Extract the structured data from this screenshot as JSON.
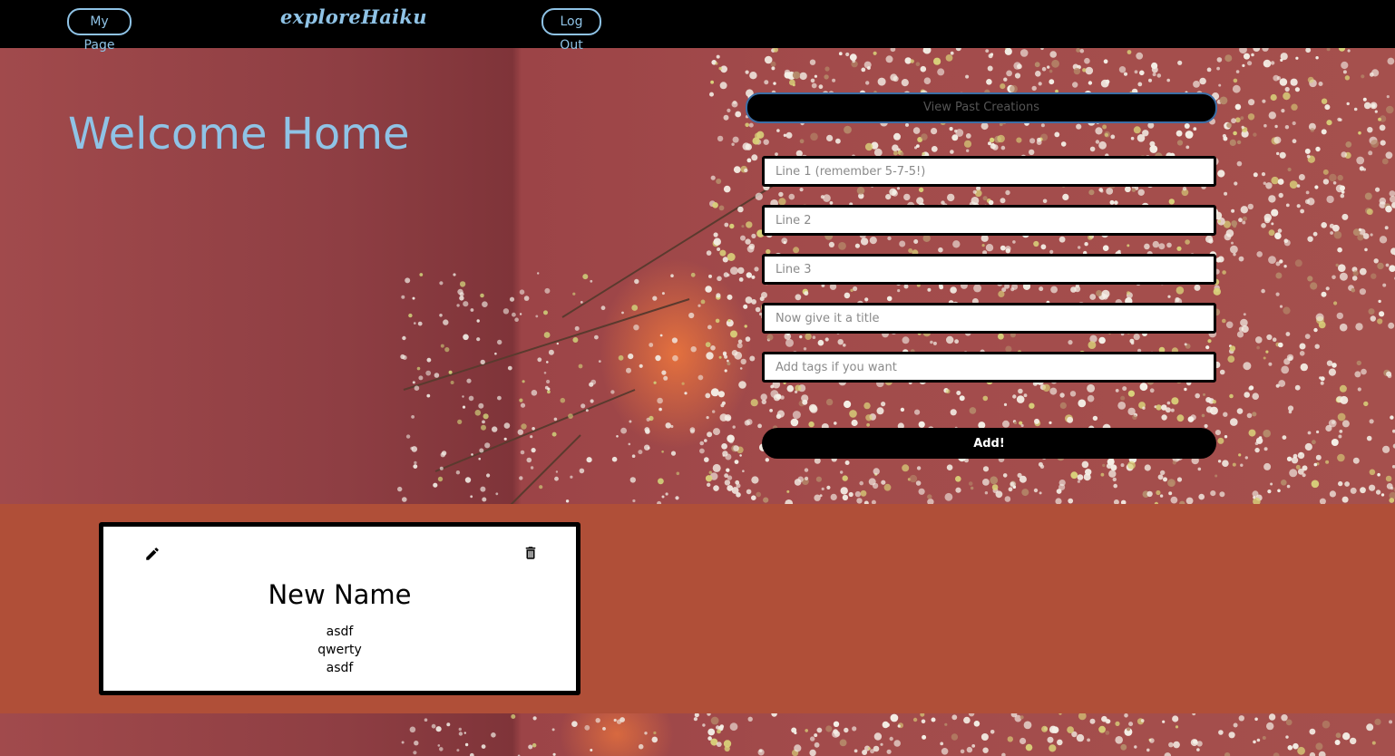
{
  "navbar": {
    "my_page": "My Page",
    "brand": "exploreHaiku",
    "log_out": "Log Out"
  },
  "hero": {
    "heading": "Welcome Home",
    "view_past": "View Past Creations"
  },
  "form": {
    "line1_placeholder": "Line 1 (remember 5-7-5!)",
    "line2_placeholder": "Line 2",
    "line3_placeholder": "Line 3",
    "title_placeholder": "Now give it a title",
    "tags_placeholder": "Add tags if you want",
    "add_label": "Add!"
  },
  "creations": [
    {
      "title": "New Name",
      "lines": [
        "asdf",
        "qwerty",
        "asdf"
      ],
      "edit_icon": "pencil-icon",
      "delete_icon": "trash-icon"
    }
  ],
  "colors": {
    "accent": "#8fc3e6",
    "navbar": "#000000",
    "band": "#b04f38"
  }
}
